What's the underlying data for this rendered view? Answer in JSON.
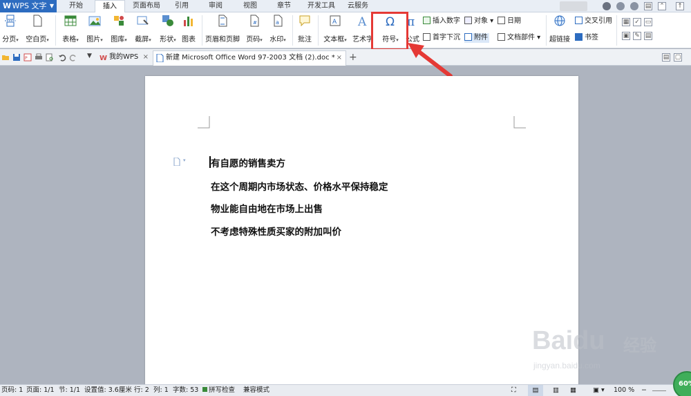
{
  "app": {
    "title": "WPS 文字"
  },
  "menu_tabs": [
    "开始",
    "插入",
    "页面布局",
    "引用",
    "审阅",
    "视图",
    "章节",
    "开发工具",
    "云服务"
  ],
  "active_menu_tab": "插入",
  "ribbon": {
    "page_break": "分页",
    "blank_page": "空白页",
    "table": "表格",
    "picture": "图片",
    "gallery": "图库",
    "screenshot": "截屏",
    "shape": "形状",
    "chart": "图表",
    "header_footer": "页眉和页脚",
    "page_number": "页码",
    "watermark": "水印",
    "comment": "批注",
    "text_box": "文本框",
    "word_art": "艺术字",
    "symbol": "符号",
    "formula": "公式",
    "insert_number": "插入数字",
    "drop_cap": "首字下沉",
    "object": "对象",
    "attachment": "附件",
    "date": "日期",
    "doc_parts": "文档部件",
    "hyperlink": "超链接",
    "cross_ref": "交叉引用",
    "bookmark": "书签"
  },
  "doc_tabs": [
    {
      "label": "我的WPS"
    },
    {
      "label": "新建 Microsoft Office Word 97-2003 文档 (2).doc *"
    }
  ],
  "document": {
    "lines": [
      "有自愿的销售卖方",
      "在这个周期内市场状态、价格水平保持稳定",
      "物业能自由地在市场上出售",
      "不考虑特殊性质买家的附加叫价"
    ]
  },
  "status": {
    "page_num": "页码: 1",
    "pages": "页面: 1/1",
    "section": "节: 1/1",
    "setting": "设置值: 3.6厘米",
    "row": "行: 2",
    "col": "列: 1",
    "words": "字数: 53",
    "spell": "拼写检查",
    "compat": "兼容模式",
    "zoom": "100 %",
    "zoom_badge": "60%"
  },
  "watermark": {
    "brand": "Baidu",
    "brand_cn": "经验",
    "url": "jingyan.baidu.com"
  },
  "colors": {
    "accent": "#2d6cc0",
    "highlight": "#e53935",
    "badge": "#3fae5a"
  }
}
